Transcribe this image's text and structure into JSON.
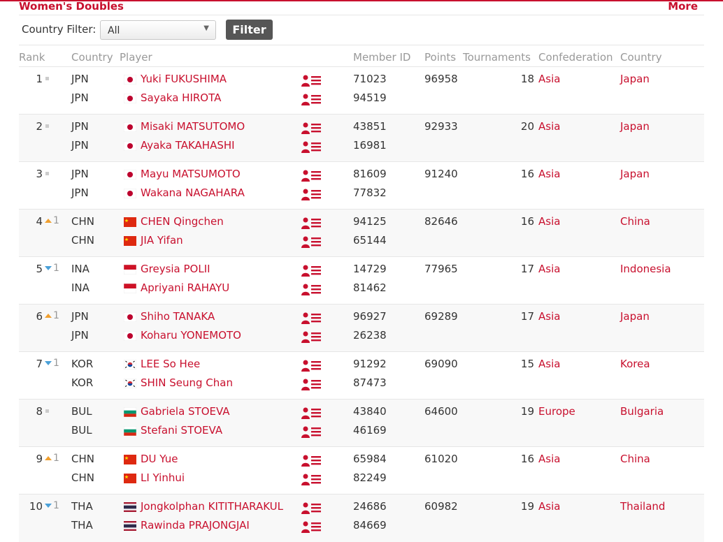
{
  "header": {
    "title": "Women's Doubles",
    "more_label": "More"
  },
  "filter": {
    "label": "Country Filter:",
    "selected": "All",
    "button_label": "Filter"
  },
  "columns": {
    "rank": "Rank",
    "country": "Country",
    "player": "Player",
    "member_id": "Member ID",
    "points": "Points",
    "tournaments": "Tournaments",
    "confederation": "Confederation",
    "country_name": "Country"
  },
  "colors": {
    "accent": "#c8102e",
    "rise": "#f0a030",
    "fall": "#4aa0d8",
    "unchanged": "#cccccc"
  },
  "icons": {
    "profile": "player-profile-icon",
    "select_arrow": "chevron-down-icon"
  },
  "rankings": [
    {
      "rank": "1",
      "change": "none",
      "change_value": "",
      "points": "96958",
      "tournaments": "18",
      "confederation": "Asia",
      "country_name": "Japan",
      "players": [
        {
          "code": "JPN",
          "flag": "JPN",
          "name": "Yuki FUKUSHIMA",
          "member_id": "71023"
        },
        {
          "code": "JPN",
          "flag": "JPN",
          "name": "Sayaka HIROTA",
          "member_id": "94519"
        }
      ]
    },
    {
      "rank": "2",
      "change": "none",
      "change_value": "",
      "points": "92933",
      "tournaments": "20",
      "confederation": "Asia",
      "country_name": "Japan",
      "players": [
        {
          "code": "JPN",
          "flag": "JPN",
          "name": "Misaki MATSUTOMO",
          "member_id": "43851"
        },
        {
          "code": "JPN",
          "flag": "JPN",
          "name": "Ayaka TAKAHASHI",
          "member_id": "16981"
        }
      ]
    },
    {
      "rank": "3",
      "change": "none",
      "change_value": "",
      "points": "91240",
      "tournaments": "16",
      "confederation": "Asia",
      "country_name": "Japan",
      "players": [
        {
          "code": "JPN",
          "flag": "JPN",
          "name": "Mayu MATSUMOTO",
          "member_id": "81609"
        },
        {
          "code": "JPN",
          "flag": "JPN",
          "name": "Wakana NAGAHARA",
          "member_id": "77832"
        }
      ]
    },
    {
      "rank": "4",
      "change": "up",
      "change_value": "1",
      "points": "82646",
      "tournaments": "16",
      "confederation": "Asia",
      "country_name": "China",
      "players": [
        {
          "code": "CHN",
          "flag": "CHN",
          "name": "CHEN Qingchen",
          "member_id": "94125"
        },
        {
          "code": "CHN",
          "flag": "CHN",
          "name": "JIA Yifan",
          "member_id": "65144"
        }
      ]
    },
    {
      "rank": "5",
      "change": "down",
      "change_value": "1",
      "points": "77965",
      "tournaments": "17",
      "confederation": "Asia",
      "country_name": "Indonesia",
      "players": [
        {
          "code": "INA",
          "flag": "INA",
          "name": "Greysia POLII",
          "member_id": "14729"
        },
        {
          "code": "INA",
          "flag": "INA",
          "name": "Apriyani RAHAYU",
          "member_id": "81462"
        }
      ]
    },
    {
      "rank": "6",
      "change": "up",
      "change_value": "1",
      "points": "69289",
      "tournaments": "17",
      "confederation": "Asia",
      "country_name": "Japan",
      "players": [
        {
          "code": "JPN",
          "flag": "JPN",
          "name": "Shiho TANAKA",
          "member_id": "96927"
        },
        {
          "code": "JPN",
          "flag": "JPN",
          "name": "Koharu YONEMOTO",
          "member_id": "26238"
        }
      ]
    },
    {
      "rank": "7",
      "change": "down",
      "change_value": "1",
      "points": "69090",
      "tournaments": "15",
      "confederation": "Asia",
      "country_name": "Korea",
      "players": [
        {
          "code": "KOR",
          "flag": "KOR",
          "name": "LEE So Hee",
          "member_id": "91292"
        },
        {
          "code": "KOR",
          "flag": "KOR",
          "name": "SHIN Seung Chan",
          "member_id": "87473"
        }
      ]
    },
    {
      "rank": "8",
      "change": "none",
      "change_value": "",
      "points": "64600",
      "tournaments": "19",
      "confederation": "Europe",
      "country_name": "Bulgaria",
      "players": [
        {
          "code": "BUL",
          "flag": "BUL",
          "name": "Gabriela STOEVA",
          "member_id": "43840"
        },
        {
          "code": "BUL",
          "flag": "BUL",
          "name": "Stefani STOEVA",
          "member_id": "46169"
        }
      ]
    },
    {
      "rank": "9",
      "change": "up",
      "change_value": "1",
      "points": "61020",
      "tournaments": "16",
      "confederation": "Asia",
      "country_name": "China",
      "players": [
        {
          "code": "CHN",
          "flag": "CHN",
          "name": "DU Yue",
          "member_id": "65984"
        },
        {
          "code": "CHN",
          "flag": "CHN",
          "name": "LI Yinhui",
          "member_id": "82249"
        }
      ]
    },
    {
      "rank": "10",
      "change": "down",
      "change_value": "1",
      "points": "60982",
      "tournaments": "19",
      "confederation": "Asia",
      "country_name": "Thailand",
      "players": [
        {
          "code": "THA",
          "flag": "THA",
          "name": "Jongkolphan KITITHARAKUL",
          "member_id": "24686"
        },
        {
          "code": "THA",
          "flag": "THA",
          "name": "Rawinda PRAJONGJAI",
          "member_id": "84669"
        }
      ]
    }
  ]
}
